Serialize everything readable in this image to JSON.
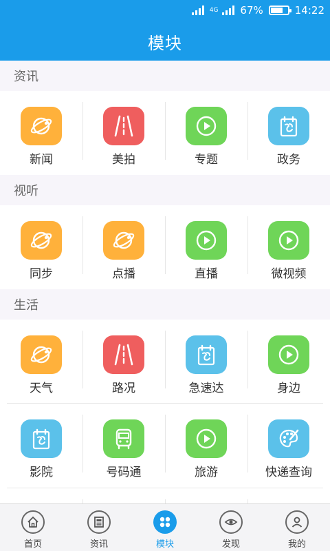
{
  "status_bar": {
    "network_label": "4G",
    "battery": "67%",
    "battery_level": 0.67,
    "time": "14:22"
  },
  "app_bar": {
    "title": "模块"
  },
  "colors": {
    "primary": "#1a9cea",
    "orange": "#ffb13b",
    "red": "#ef5e5e",
    "green": "#6fd558",
    "blue": "#5bc1ea"
  },
  "sections": [
    {
      "title": "资讯",
      "rows": [
        [
          {
            "label": "新闻",
            "icon": "planet-icon",
            "color": "orange"
          },
          {
            "label": "美拍",
            "icon": "road-icon",
            "color": "red"
          },
          {
            "label": "专题",
            "icon": "play-icon",
            "color": "green"
          },
          {
            "label": "政务",
            "icon": "calendar-icon",
            "color": "blue"
          }
        ]
      ]
    },
    {
      "title": "视听",
      "rows": [
        [
          {
            "label": "同步",
            "icon": "planet-icon",
            "color": "orange"
          },
          {
            "label": "点播",
            "icon": "planet-icon",
            "color": "orange"
          },
          {
            "label": "直播",
            "icon": "play-icon",
            "color": "green"
          },
          {
            "label": "微视频",
            "icon": "play-icon",
            "color": "green"
          }
        ]
      ]
    },
    {
      "title": "生活",
      "rows": [
        [
          {
            "label": "天气",
            "icon": "planet-icon",
            "color": "orange"
          },
          {
            "label": "路况",
            "icon": "road-icon",
            "color": "red"
          },
          {
            "label": "急速达",
            "icon": "calendar-icon",
            "color": "blue"
          },
          {
            "label": "身边",
            "icon": "play-icon",
            "color": "green"
          }
        ],
        [
          {
            "label": "影院",
            "icon": "calendar-icon",
            "color": "blue"
          },
          {
            "label": "号码通",
            "icon": "bus-icon",
            "color": "green"
          },
          {
            "label": "旅游",
            "icon": "play-icon",
            "color": "green"
          },
          {
            "label": "快递查询",
            "icon": "palette-icon",
            "color": "blue"
          }
        ],
        [
          {
            "label": "",
            "icon": "road-icon",
            "color": "red"
          },
          {
            "label": "",
            "icon": "calendar-icon",
            "color": "blue"
          },
          {
            "label": "",
            "icon": "calendar-icon",
            "color": "blue"
          },
          {
            "label": "",
            "icon": "",
            "color": ""
          }
        ]
      ]
    }
  ],
  "bottom_nav": [
    {
      "label": "首页",
      "icon": "home-icon",
      "active": false
    },
    {
      "label": "资讯",
      "icon": "news-icon",
      "active": false
    },
    {
      "label": "模块",
      "icon": "modules-icon",
      "active": true
    },
    {
      "label": "发现",
      "icon": "eye-icon",
      "active": false
    },
    {
      "label": "我的",
      "icon": "user-icon",
      "active": false
    }
  ]
}
